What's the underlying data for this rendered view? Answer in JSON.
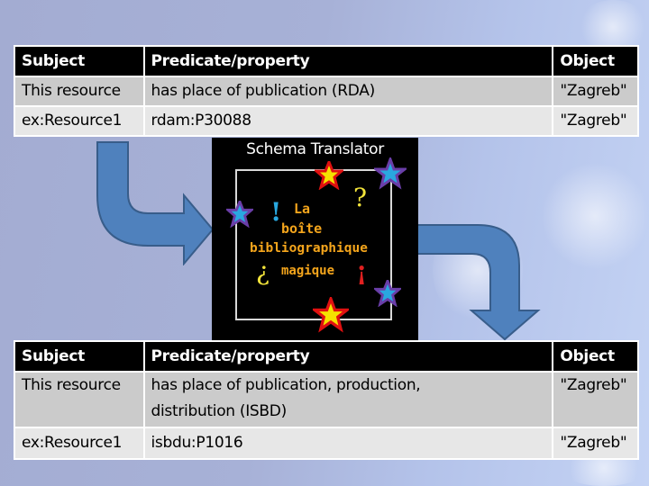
{
  "top_table": {
    "headers": [
      "Subject",
      "Predicate/property",
      "Object"
    ],
    "rows": [
      [
        "This resource",
        "has place of publication (RDA)",
        "\"Zagreb\""
      ],
      [
        "ex:Resource1",
        "rdam:P30088",
        "\"Zagreb\""
      ]
    ]
  },
  "translator": {
    "title": "Schema Translator",
    "logo_lines": [
      "La",
      "boîte",
      "bibliographique",
      "magique"
    ],
    "marks": [
      "!",
      "?",
      "¿",
      "¡"
    ],
    "icons": [
      "star-icon",
      "star-icon",
      "star-icon",
      "star-icon",
      "star-icon"
    ]
  },
  "bottom_table": {
    "headers": [
      "Subject",
      "Predicate/property",
      "Object"
    ],
    "rows": [
      [
        "This resource",
        "has place of publication, production, distribution (ISBD)",
        "\"Zagreb\""
      ],
      [
        "ex:Resource1",
        "isbdu:P1016",
        "\"Zagreb\""
      ]
    ]
  },
  "colors": {
    "arrow_fill": "#4f81bd",
    "arrow_stroke": "#385d8a",
    "header_bg": "#000000",
    "row_odd": "#cbcbcb",
    "row_even": "#e7e7e7",
    "logo_text": "#f4a51c"
  }
}
